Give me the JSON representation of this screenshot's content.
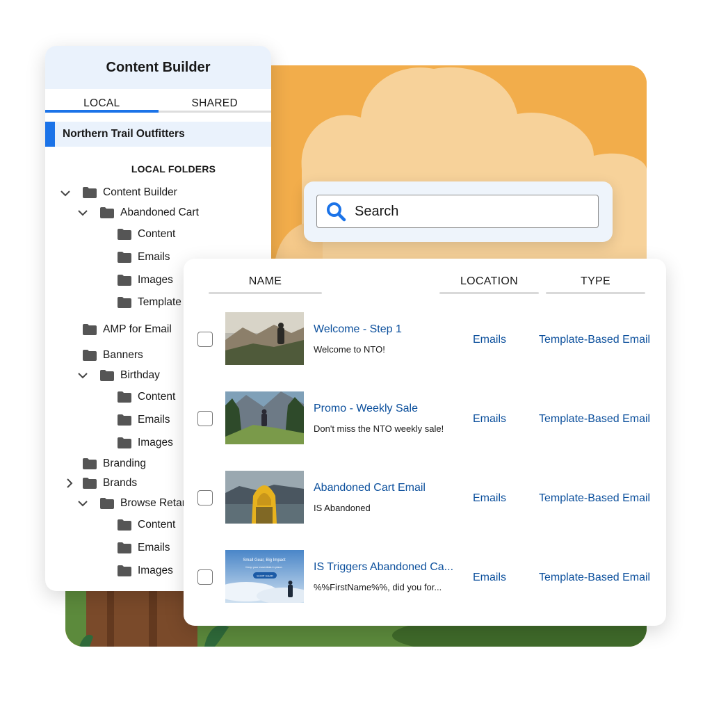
{
  "search": {
    "placeholder": "Search"
  },
  "panel": {
    "title": "Content Builder",
    "tabs": [
      {
        "label": "LOCAL",
        "active": true
      },
      {
        "label": "SHARED",
        "active": false
      }
    ],
    "selected_org": "Northern Trail Outfitters",
    "section_title": "LOCAL FOLDERS",
    "tree": [
      {
        "label": "Content Builder",
        "chevron": "down"
      },
      {
        "label": "Abandoned Cart",
        "chevron": "down"
      },
      {
        "label": "Content"
      },
      {
        "label": "Emails"
      },
      {
        "label": "Images"
      },
      {
        "label": "Template"
      },
      {
        "label": "AMP for Email"
      },
      {
        "label": "Banners"
      },
      {
        "label": "Birthday",
        "chevron": "down"
      },
      {
        "label": "Content"
      },
      {
        "label": "Emails"
      },
      {
        "label": "Images"
      },
      {
        "label": "Branding"
      },
      {
        "label": "Brands",
        "chevron": "right"
      },
      {
        "label": "Browse Retar",
        "chevron": "down"
      },
      {
        "label": "Content"
      },
      {
        "label": "Emails"
      },
      {
        "label": "Images"
      }
    ]
  },
  "table": {
    "columns": {
      "name": "NAME",
      "location": "LOCATION",
      "type": "TYPE"
    },
    "rows": [
      {
        "title": "Welcome - Step 1",
        "subtitle": "Welcome to NTO!",
        "location": "Emails",
        "type": "Template-Based Email",
        "thumb": "mountain-hiker-image"
      },
      {
        "title": "Promo - Weekly Sale",
        "subtitle": "Don't miss the NTO weekly sale!",
        "location": "Emails",
        "type": "Template-Based Email",
        "thumb": "trail-hiker-image"
      },
      {
        "title": "Abandoned Cart Email",
        "subtitle": "IS Abandoned",
        "location": "Emails",
        "type": "Template-Based Email",
        "thumb": "yellow-jacket-lake-image"
      },
      {
        "title": "IS Triggers Abandoned Ca...",
        "subtitle": "%%FirstName%%, did you for...",
        "location": "Emails",
        "type": "Template-Based Email",
        "thumb": "email-banner-image",
        "thumb_text": {
          "headline": "Small Gear, Big Impact",
          "subline": "Keep your essentials in place.",
          "button": "SHOP GEAR"
        }
      }
    ]
  },
  "colors": {
    "accent": "#1b73e8",
    "link": "#0b4f9c",
    "illustration_orange": "#f2ad4b",
    "illustration_green": "#5c8a3c"
  }
}
